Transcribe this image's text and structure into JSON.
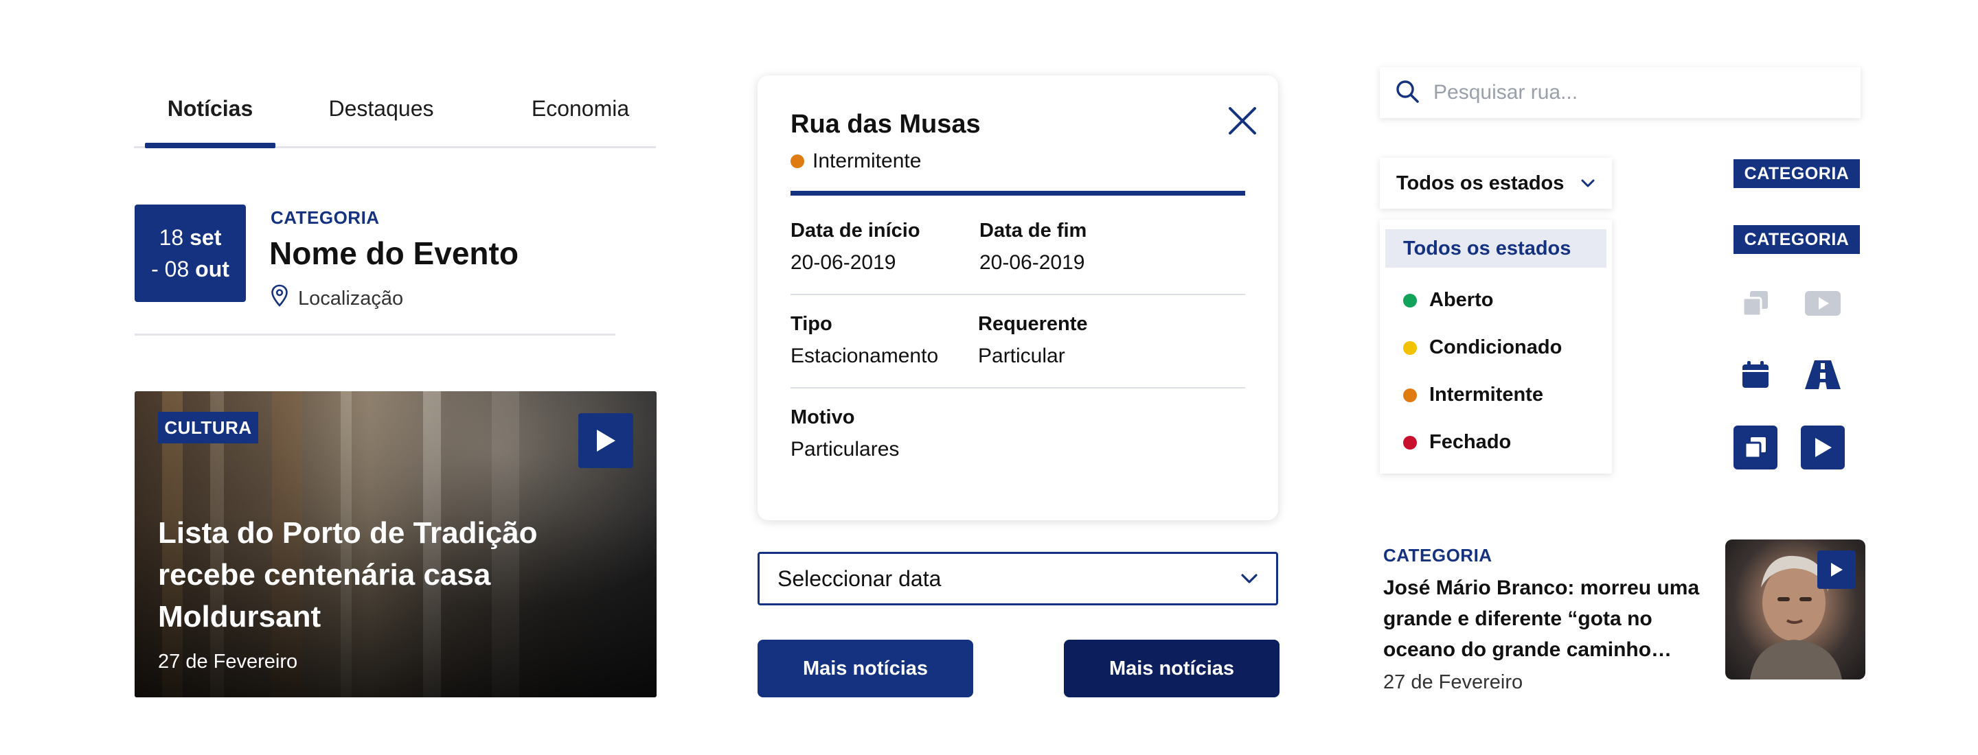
{
  "tabs": {
    "items": [
      {
        "label": "Notícias",
        "active": true
      },
      {
        "label": "Destaques",
        "active": false
      },
      {
        "label": "Economia",
        "active": false
      }
    ]
  },
  "event": {
    "date_line1_day": "18",
    "date_line1_month": "set",
    "date_line2_day": "- 08",
    "date_line2_month": "out",
    "category": "CATEGORIA",
    "title": "Nome do Evento",
    "location": "Localização"
  },
  "featured_news": {
    "badge": "CULTURA",
    "headline": "Lista do Porto de Tradição recebe centenária casa Moldursant",
    "date": "27 de Fevereiro"
  },
  "street_card": {
    "title": "Rua das Musas",
    "status": "Intermitente",
    "status_color": "#e07b12",
    "fields": {
      "start_label": "Data de início",
      "start_value": "20-06-2019",
      "end_label": "Data de fim",
      "end_value": "20-06-2019",
      "type_label": "Tipo",
      "type_value": "Estacionamento",
      "requester_label": "Requerente",
      "requester_value": "Particular",
      "reason_label": "Motivo",
      "reason_value": "Particulares"
    }
  },
  "date_select": {
    "label": "Seleccionar data"
  },
  "buttons": {
    "more_news_1": "Mais notícias",
    "more_news_2": "Mais notícias"
  },
  "search": {
    "placeholder": "Pesquisar rua..."
  },
  "status_filter": {
    "selected": "Todos os estados",
    "options": [
      {
        "label": "Todos os estados",
        "color": ""
      },
      {
        "label": "Aberto",
        "color": "#12a35a"
      },
      {
        "label": "Condicionado",
        "color": "#f2c200"
      },
      {
        "label": "Intermitente",
        "color": "#e07b12"
      },
      {
        "label": "Fechado",
        "color": "#c8102e"
      }
    ]
  },
  "category_badges": [
    "CATEGORIA",
    "CATEGORIA"
  ],
  "icons": [
    "gallery-outline-icon",
    "video-outline-icon",
    "calendar-icon",
    "road-icon",
    "gallery-filled-icon",
    "play-filled-icon"
  ],
  "side_news": {
    "category": "CATEGORIA",
    "title": "José Mário Branco: morreu uma grande e diferente “gota no oceano do grande caminho…",
    "date": "27 de Fevereiro"
  },
  "colors": {
    "brand": "#14327f",
    "brand_dark": "#0c1f5c",
    "icon_muted": "#c7cbd3"
  }
}
